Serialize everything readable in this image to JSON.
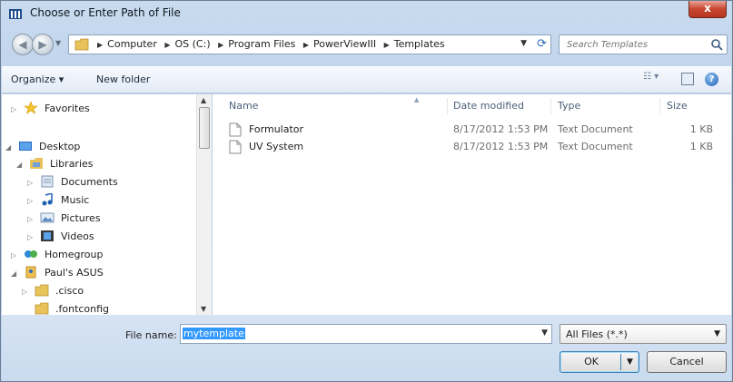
{
  "window": {
    "title": "Choose or Enter Path of File",
    "close_glyph": "x"
  },
  "address": {
    "crumbs": [
      "Computer",
      "OS (C:)",
      "Program Files",
      "PowerViewIII",
      "Templates"
    ],
    "search_placeholder": "Search Templates"
  },
  "toolbar": {
    "organize_label": "Organize ▾",
    "new_folder_label": "New folder",
    "help_glyph": "?"
  },
  "nav": {
    "items": [
      {
        "label": "Favorites",
        "icon": "star-icon"
      },
      {
        "label": "Desktop",
        "icon": "desktop-icon"
      },
      {
        "label": "Libraries",
        "icon": "libraries-icon"
      },
      {
        "label": "Documents",
        "icon": "documents-icon"
      },
      {
        "label": "Music",
        "icon": "music-icon"
      },
      {
        "label": "Pictures",
        "icon": "pictures-icon"
      },
      {
        "label": "Videos",
        "icon": "videos-icon"
      },
      {
        "label": "Homegroup",
        "icon": "homegroup-icon"
      },
      {
        "label": "Paul's ASUS",
        "icon": "user-icon"
      },
      {
        "label": ".cisco",
        "icon": "folder-icon"
      },
      {
        "label": ".fontconfig",
        "icon": "folder-icon"
      }
    ]
  },
  "files": {
    "headers": {
      "name": "Name",
      "date": "Date modified",
      "type": "Type",
      "size": "Size"
    },
    "rows": [
      {
        "name": "Formulator",
        "date": "8/17/2012 1:53 PM",
        "type": "Text Document",
        "size": "1 KB"
      },
      {
        "name": "UV System",
        "date": "8/17/2012 1:53 PM",
        "type": "Text Document",
        "size": "1 KB"
      }
    ]
  },
  "bottom": {
    "filename_label": "File name:",
    "filename_value": "mytemplate",
    "filter_value": "All Files (*.*)",
    "ok_label": "OK",
    "cancel_label": "Cancel"
  },
  "colors": {
    "accent": "#3399ff",
    "chrome": "#c9dbef",
    "close": "#c7462f"
  }
}
